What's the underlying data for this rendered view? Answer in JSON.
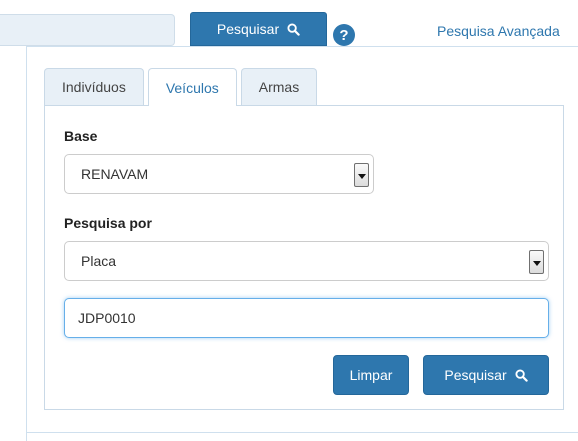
{
  "header": {
    "search_button_label": "Pesquisar",
    "help_icon_glyph": "?",
    "advanced_search_label": "Pesquisa Avançada"
  },
  "tabs": [
    {
      "label": "Indivíduos",
      "active": false
    },
    {
      "label": "Veículos",
      "active": true
    },
    {
      "label": "Armas",
      "active": false
    }
  ],
  "form": {
    "base_label": "Base",
    "base_selected": "RENAVAM",
    "search_by_label": "Pesquisa por",
    "search_by_selected": "Placa",
    "query_value": "JDP0010",
    "clear_button_label": "Limpar",
    "search_button_label": "Pesquisar"
  },
  "colors": {
    "accent": "#2e77ae",
    "tab_inactive_bg": "#e8f0f7",
    "focus_border": "#66afe9"
  },
  "icons": [
    "search-icon",
    "help-icon",
    "dropdown-arrow-icon"
  ]
}
